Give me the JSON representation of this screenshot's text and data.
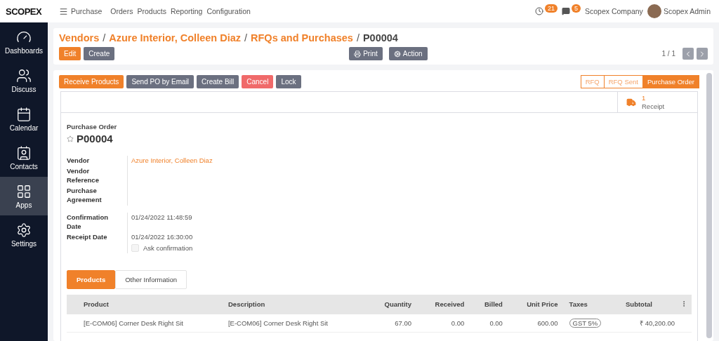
{
  "topbar": {
    "logo": "SCOPEX",
    "app": "Purchase",
    "menu": [
      "Orders",
      "Products",
      "Reporting",
      "Configuration"
    ],
    "activity_count": "21",
    "message_count": "5",
    "company": "Scopex Company",
    "user": "Scopex Admin"
  },
  "sidebar": {
    "items": [
      {
        "label": "Dashboards",
        "selected": false
      },
      {
        "label": "Discuss",
        "selected": false
      },
      {
        "label": "Calendar",
        "selected": false
      },
      {
        "label": "Contacts",
        "selected": false
      },
      {
        "label": "Apps",
        "selected": true
      },
      {
        "label": "Settings",
        "selected": false
      }
    ]
  },
  "breadcrumb": [
    {
      "label": "Vendors",
      "link": true
    },
    {
      "separator": "/",
      "label": "Azure Interior, Colleen Diaz",
      "link": true
    },
    {
      "separator": "/",
      "label": "RFQs and Purchases",
      "link": true
    },
    {
      "separator": "/",
      "label": "P00004",
      "link": false
    }
  ],
  "control_buttons": [
    {
      "label": "Edit",
      "kind": "primary"
    },
    {
      "label": "Create",
      "kind": "secondary"
    }
  ],
  "action_buttons": [
    {
      "label": "Print"
    },
    {
      "label": "Action"
    }
  ],
  "pager": "1 / 1",
  "header_buttons": [
    {
      "label": "Receive Products",
      "kind": "primary"
    },
    {
      "label": "Send PO by Email",
      "kind": "secondary"
    },
    {
      "label": "Create Bill",
      "kind": "secondary"
    },
    {
      "label": "Cancel",
      "kind": "danger"
    },
    {
      "label": "Lock",
      "kind": "secondary"
    }
  ],
  "statusbar": [
    {
      "label": "RFQ",
      "selected": false
    },
    {
      "label": "RFQ Sent",
      "selected": false
    },
    {
      "label": "Purchase Order",
      "selected": true
    }
  ],
  "smart_button": {
    "count": "1",
    "label": "Receipt"
  },
  "form": {
    "doc_type": "Purchase Order",
    "name": "P00004",
    "starred": false,
    "group_1": [
      {
        "label": "Vendor",
        "value": "Azure Interior, Colleen Diaz"
      },
      {
        "label": "Vendor Reference"
      },
      {
        "label": "Purchase Agreement"
      }
    ],
    "group_2": [
      {
        "label": "Confirmation Date",
        "value": "01/24/2022 11:48:59"
      },
      {
        "label": "Receipt Date",
        "value": "01/24/2022 16:30:00"
      }
    ],
    "ask_confirmation": {
      "label": "Ask confirmation",
      "checked": false
    }
  },
  "tabs": [
    {
      "label": "Products",
      "selected": true
    },
    {
      "label": "Other Information",
      "selected": false
    }
  ],
  "table": {
    "columns": [
      "Product",
      "Description",
      "Quantity",
      "Received",
      "Billed",
      "Unit Price",
      "Taxes",
      "Subtotal"
    ],
    "rows": [
      {
        "product": "[E-COM06] Corner Desk Right Sit",
        "description": "[E-COM06] Corner Desk Right Sit",
        "quantity": "67.00",
        "received": "0.00",
        "billed": "0.00",
        "unit_price": "600.00",
        "taxes": "GST 5%",
        "subtotal": "₹ 40,200.00"
      }
    ]
  }
}
